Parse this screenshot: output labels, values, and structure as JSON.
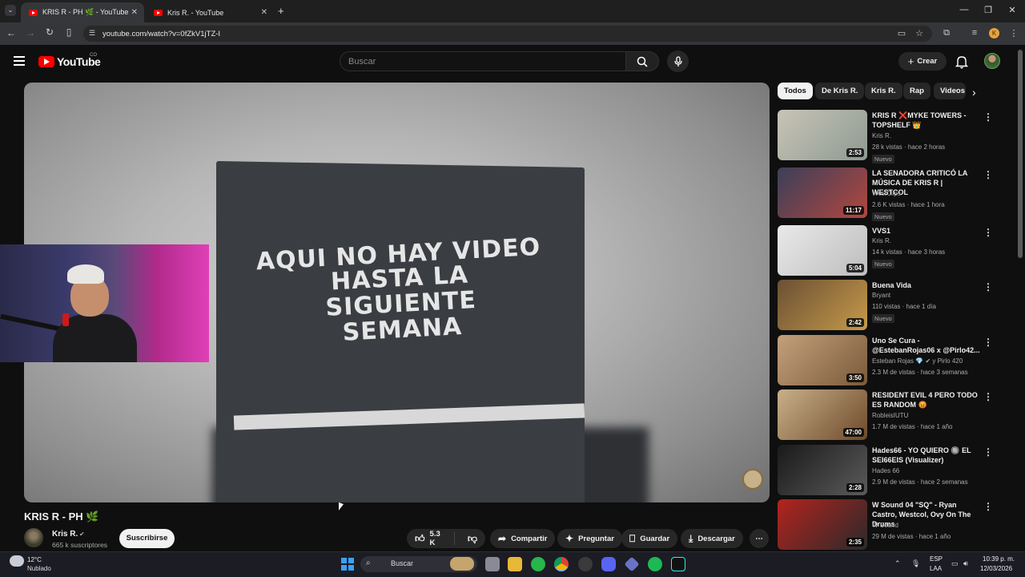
{
  "browser": {
    "tabs": [
      {
        "title": "KRIS R - PH 🌿 - YouTube",
        "active": true
      },
      {
        "title": "Kris R. - YouTube",
        "active": false
      }
    ],
    "new_tab": "+",
    "url": "youtube.com/watch?v=0fZkV1jTZ-I",
    "profile_initial": "K"
  },
  "header": {
    "logo_text": "YouTube",
    "country_code": "CO",
    "search_placeholder": "Buscar",
    "create_label": "Crear"
  },
  "video": {
    "overlay_text": [
      "AQUI NO HAY VIDEO HASTA LA",
      "SIGUIENTE",
      "SEMANA"
    ],
    "title": "KRIS R - PH 🌿",
    "channel": "Kris R.",
    "subscribers": "665 k suscriptores",
    "subscribe_label": "Suscribirse",
    "likes": "5.3 K",
    "actions": [
      "Compartir",
      "Preguntar",
      "Guardar",
      "Descargar"
    ]
  },
  "chips": [
    "Todos",
    "De Kris R.",
    "Kris R.",
    "Rap",
    "Videos"
  ],
  "recommendations": [
    {
      "title": "KRIS R ❌MYKE TOWERS - TOPSHELF 👑",
      "channel": "Kris R.",
      "meta": "28 k vistas · hace 2 horas",
      "badge": "Nuevo",
      "duration": "2:53",
      "colors": [
        "#c9c4b6",
        "#8d9a92"
      ]
    },
    {
      "title": "LA SENADORA CRITICÓ LA MÚSICA DE KRIS R | WESTCOL",
      "channel": "WestClips",
      "meta": "2.6 K vistas · hace 1 hora",
      "badge": "Nuevo",
      "duration": "11:17",
      "colors": [
        "#3a3f5a",
        "#b3473e"
      ]
    },
    {
      "title": "VVS1",
      "channel": "Kris R.",
      "meta": "14 k vistas · hace 3 horas",
      "badge": "Nuevo",
      "duration": "5:04",
      "colors": [
        "#e9e9e9",
        "#bdbdbd"
      ]
    },
    {
      "title": "Buena Vida",
      "channel": "Bryant",
      "meta": "110 vistas · hace 1 día",
      "badge": "Nuevo",
      "duration": "2:42",
      "colors": [
        "#6a5034",
        "#c79a4a"
      ]
    },
    {
      "title": "Uno Se Cura - @EstebanRojas06 x @Pirlo42...",
      "channel": "Esteban Rojas 💎 ✔ y Pirlo 420",
      "meta": "2.3 M de vistas · hace 3 semanas",
      "badge": "",
      "duration": "3:50",
      "colors": [
        "#c4a07c",
        "#7a5a3a"
      ]
    },
    {
      "title": "RESIDENT EVIL 4 PERO TODO ES RANDOM 😡",
      "channel": "RobleisIUTU",
      "meta": "1.7 M de vistas · hace 1 año",
      "badge": "",
      "duration": "47:00",
      "colors": [
        "#c8b08a",
        "#6e4a2a"
      ]
    },
    {
      "title": "Hades66 - YO QUIERO 🔘 EL SEI66EIS (Visualizer)",
      "channel": "Hades 66",
      "meta": "2.9 M de vistas · hace 2 semanas",
      "badge": "",
      "duration": "2:28",
      "colors": [
        "#1a1a1a",
        "#5a5a5a"
      ]
    },
    {
      "title": "W Sound 04 \"SQ\" - Ryan Castro, Westcol, Ovy On The Drums",
      "channel": "W Sound",
      "meta": "29 M de vistas · hace 1 año",
      "badge": "",
      "duration": "2:35",
      "colors": [
        "#b4231e",
        "#2a2a2a"
      ]
    }
  ],
  "taskbar": {
    "temperature": "12°C",
    "weather": "Nublado",
    "search_placeholder": "Buscar",
    "lang1": "ESP",
    "lang2": "LAA",
    "time": "10:39 p. m.",
    "date": "12/03/2026"
  },
  "icons": {
    "back": "arrow-left-icon",
    "forward": "arrow-right-icon",
    "reload": "reload-icon",
    "search": "search-icon",
    "mic": "mic-icon",
    "bell": "bell-icon"
  }
}
